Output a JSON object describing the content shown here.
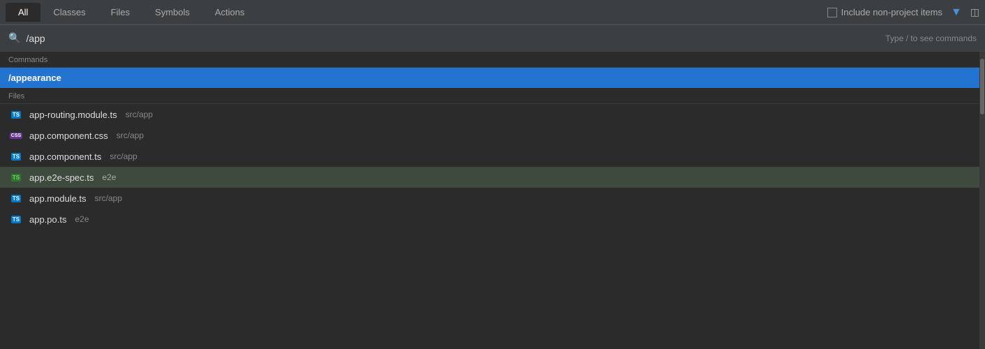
{
  "tabs": [
    {
      "id": "all",
      "label": "All",
      "active": true
    },
    {
      "id": "classes",
      "label": "Classes",
      "active": false
    },
    {
      "id": "files",
      "label": "Files",
      "active": false
    },
    {
      "id": "symbols",
      "label": "Symbols",
      "active": false
    },
    {
      "id": "actions",
      "label": "Actions",
      "active": false
    }
  ],
  "header": {
    "include_label": "Include non-project items",
    "hint": "Type / to see commands"
  },
  "search": {
    "value": "/app",
    "placeholder": "/app"
  },
  "sections": [
    {
      "id": "commands",
      "label": "Commands",
      "items": [
        {
          "id": "appearance",
          "name": "/appearance",
          "path": "",
          "icon_type": "none",
          "selected": true
        }
      ]
    },
    {
      "id": "files",
      "label": "Files",
      "items": [
        {
          "id": "app-routing",
          "name": "app-routing.module.ts",
          "path": "src/app",
          "icon_type": "ts"
        },
        {
          "id": "app-component-css",
          "name": "app.component.css",
          "path": "src/app",
          "icon_type": "css"
        },
        {
          "id": "app-component-ts",
          "name": "app.component.ts",
          "path": "src/app",
          "icon_type": "ts"
        },
        {
          "id": "app-e2e-spec",
          "name": "app.e2e-spec.ts",
          "path": "e2e",
          "icon_type": "ts-green",
          "hovered": true
        },
        {
          "id": "app-module",
          "name": "app.module.ts",
          "path": "src/app",
          "icon_type": "ts"
        },
        {
          "id": "app-po",
          "name": "app.po.ts",
          "path": "e2e",
          "icon_type": "ts"
        }
      ]
    }
  ],
  "icons": {
    "ts_label": "TS",
    "css_label": "CSS"
  }
}
